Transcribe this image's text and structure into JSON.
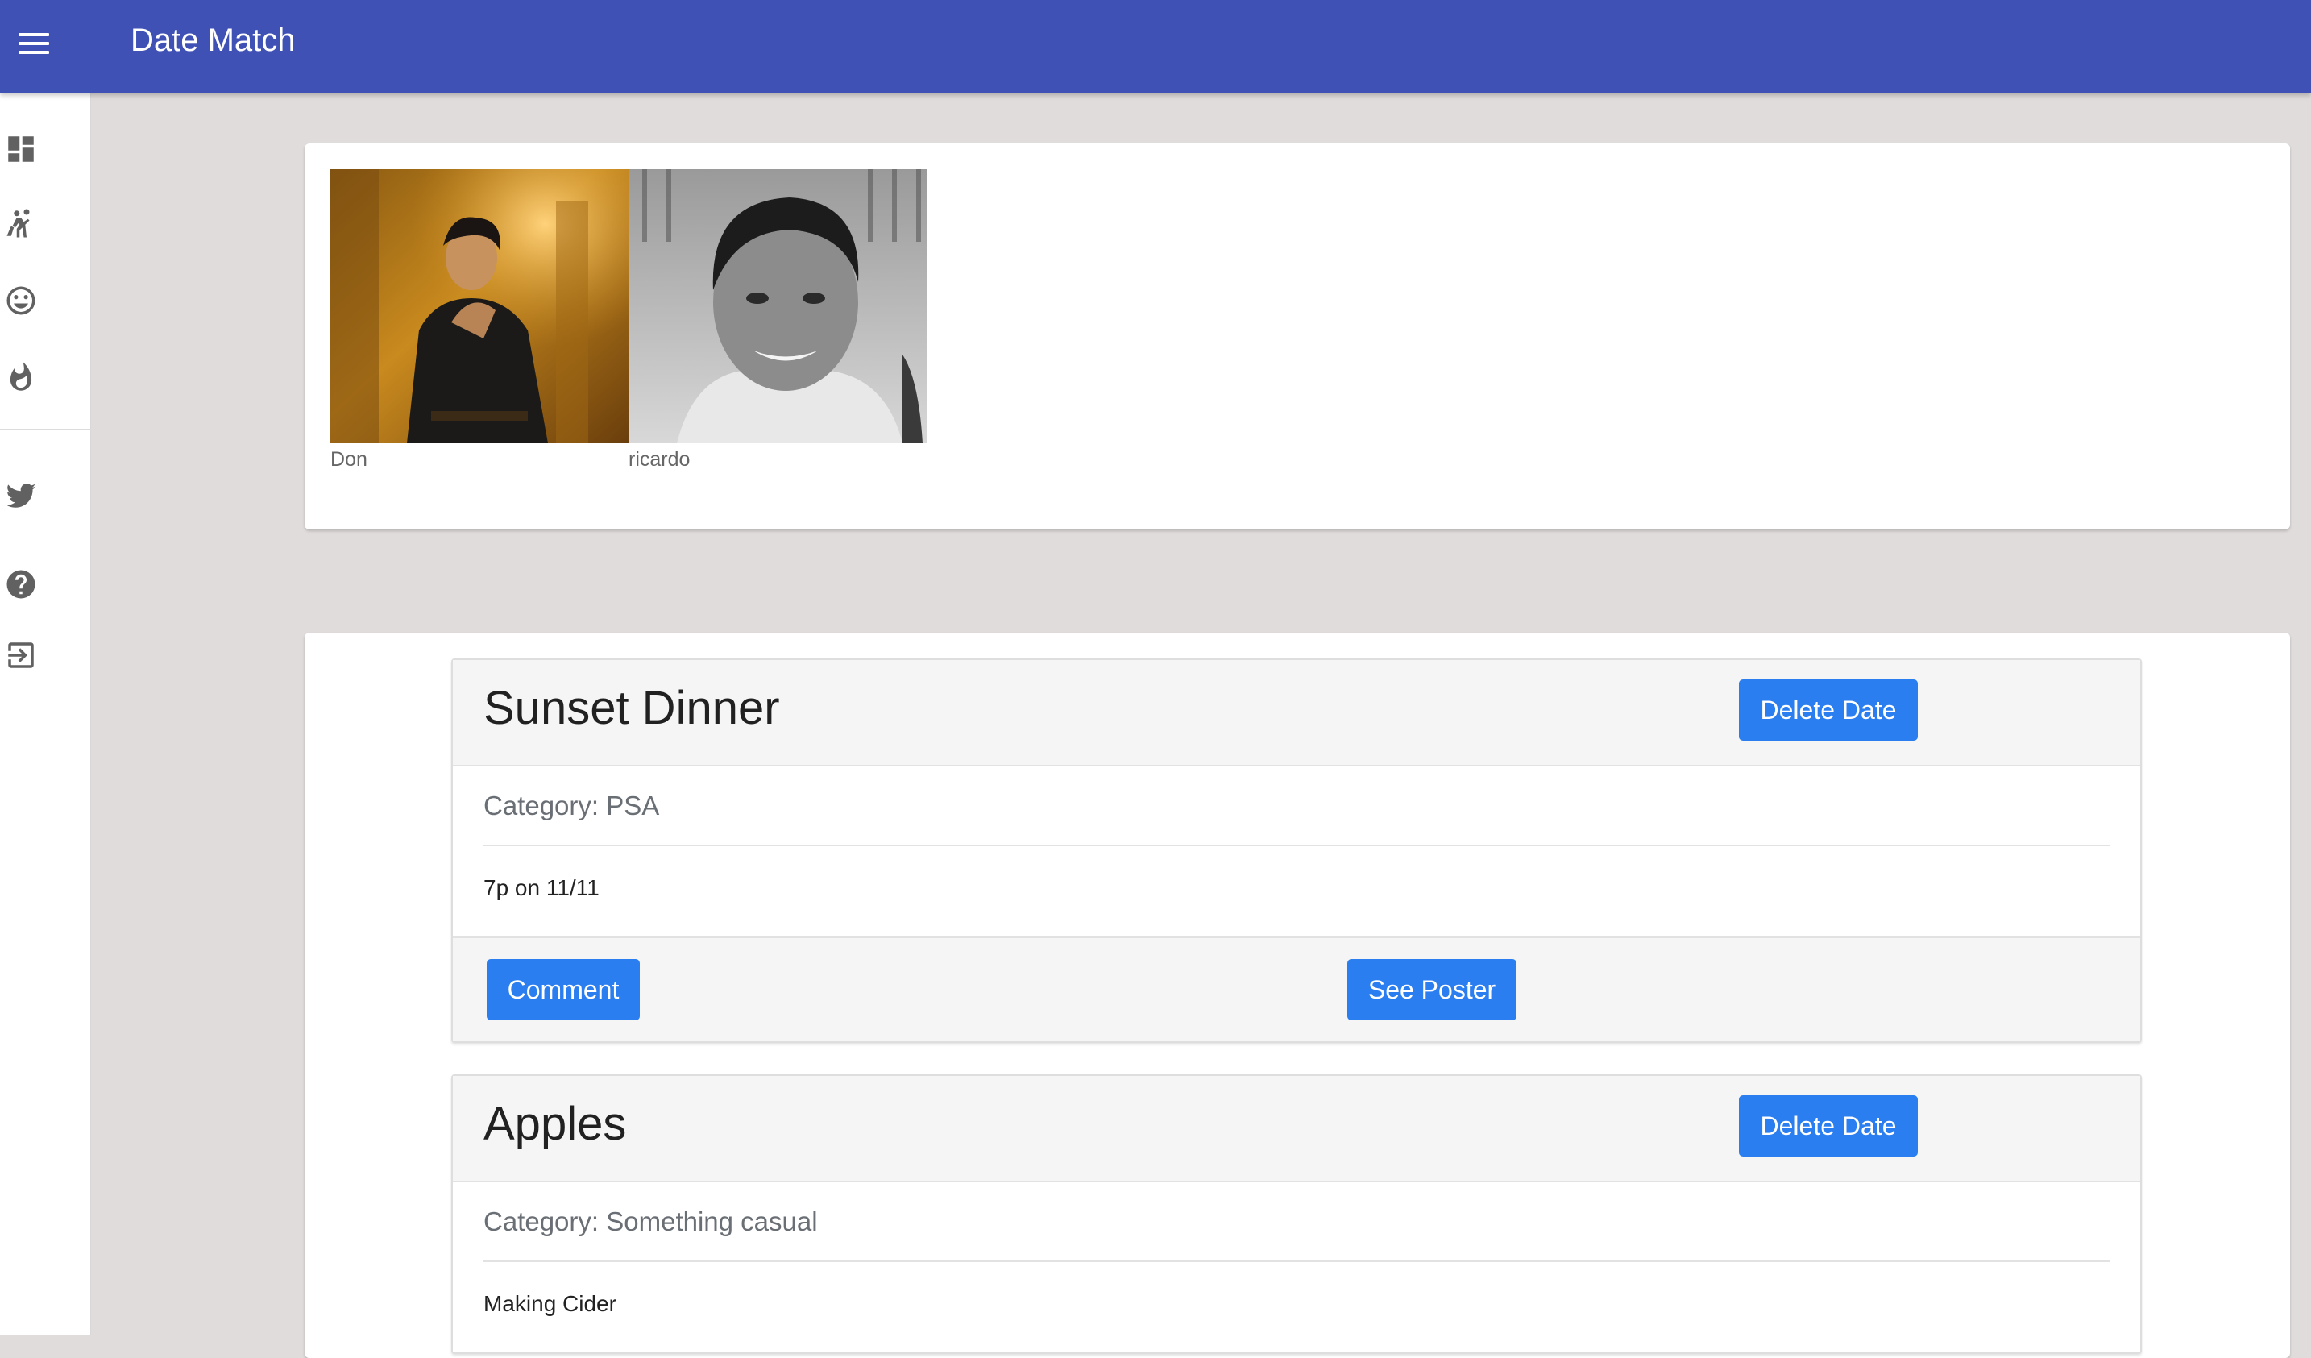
{
  "app": {
    "title": "Date Match"
  },
  "sidebar": {
    "items": [
      {
        "icon": "dashboard-icon"
      },
      {
        "icon": "people-dancing-icon"
      },
      {
        "icon": "smiley-face-icon"
      },
      {
        "icon": "fire-icon"
      },
      {
        "icon": "twitter-icon"
      },
      {
        "icon": "help-icon"
      },
      {
        "icon": "exit-icon"
      }
    ]
  },
  "matches": [
    {
      "name": "Don"
    },
    {
      "name": "ricardo"
    }
  ],
  "dates": [
    {
      "title": "Sunset Dinner",
      "category": "Category: PSA",
      "description": "7p on 11/11",
      "delete_label": "Delete Date",
      "comment_label": "Comment",
      "poster_label": "See Poster"
    },
    {
      "title": "Apples",
      "category": "Category: Something casual",
      "description": "Making Cider",
      "delete_label": "Delete Date"
    }
  ],
  "colors": {
    "appbar": "#3f51b5",
    "button": "#2a7ef0",
    "background": "#e1dcdc"
  }
}
